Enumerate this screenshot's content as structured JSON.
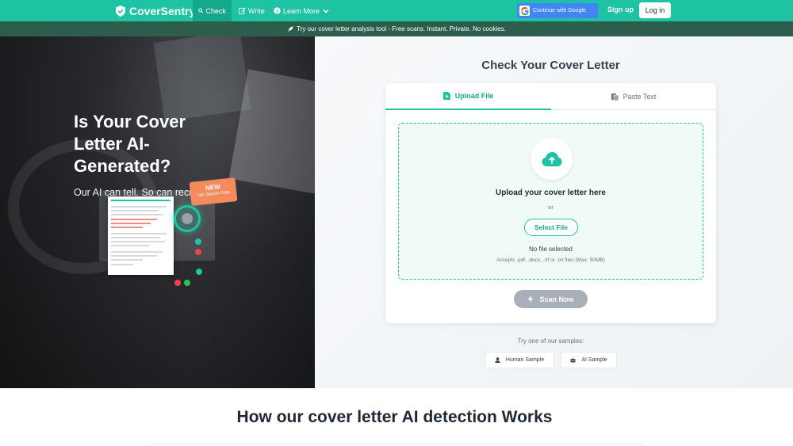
{
  "navbar": {
    "brand": "CoverSentry",
    "items": [
      {
        "label": "Check",
        "icon": "search-icon",
        "active": true
      },
      {
        "label": "Write",
        "icon": "edit-icon",
        "active": false
      },
      {
        "label": "Learn More",
        "icon": "info-icon",
        "active": false
      }
    ],
    "google_label": "Continue with Google",
    "signup_label": "Sign up",
    "login_label": "Log in"
  },
  "banner": {
    "text": "Try our cover letter analysis tool - Free scans. Instant. Private. No cookies.",
    "icon": "rocket-icon"
  },
  "hero": {
    "title": "Is Your Cover Letter AI-Generated?",
    "subtitle": "Our AI can tell. So can recruiters.",
    "badge_new": "NEW",
    "badge_sub": "Job Search Data"
  },
  "checker": {
    "title": "Check Your Cover Letter",
    "tabs": [
      {
        "label": "Upload File",
        "icon": "file-upload-icon",
        "active": true
      },
      {
        "label": "Paste Text",
        "icon": "paste-icon",
        "active": false
      }
    ],
    "upload_title": "Upload your cover letter here",
    "or_label": "or",
    "select_file_label": "Select File",
    "no_file_label": "No file selected",
    "accepts_label": "Accepts .pdf, .docx, .rtf or .txt files (Max: 50MB)",
    "scan_label": "Scan Now",
    "samples_label": "Try one of our samples:",
    "samples": [
      {
        "label": "Human Sample",
        "icon": "user-icon"
      },
      {
        "label": "AI Sample",
        "icon": "robot-icon"
      }
    ]
  },
  "how": {
    "title": "How our cover letter AI detection Works"
  },
  "colors": {
    "brand": "#1ec3a4",
    "banner": "#2d5e4c",
    "google": "#4285f4",
    "badge": "#f58a5c"
  }
}
